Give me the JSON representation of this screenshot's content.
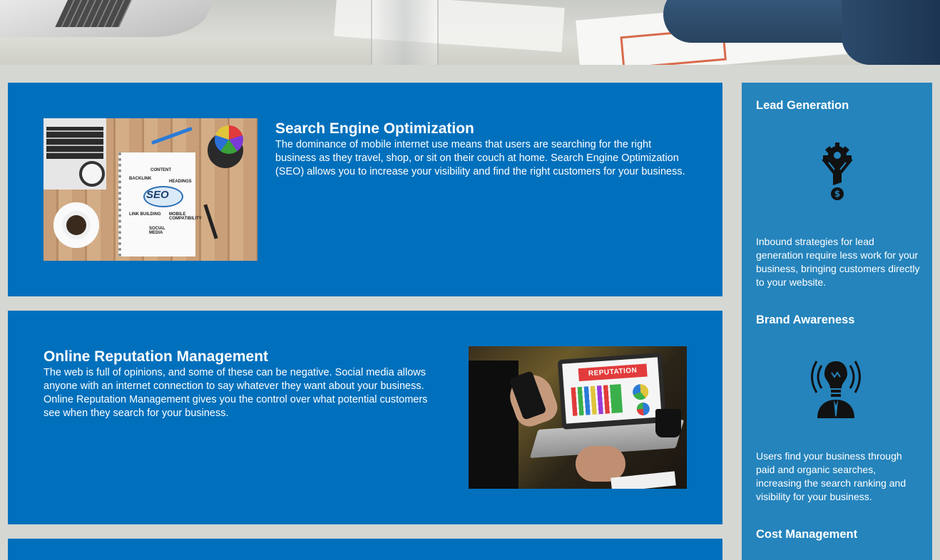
{
  "services": [
    {
      "title": "Search Engine Optimization",
      "description": "The dominance of mobile internet use means that users are searching for the right business as they travel, shop, or sit on their couch at home. Search Engine Optimization (SEO) allows you to increase your visibility and find the right customers for your business.",
      "image": {
        "cloud_text": "SEO",
        "labels": [
          "CONTENT",
          "BACKLINK",
          "HEADINGS",
          "LINK BUILDING",
          "MOBILE COMPATIBILITY",
          "SOCIAL MEDIA"
        ]
      }
    },
    {
      "title": "Online Reputation Management",
      "description": "The web is full of opinions, and some of these can be negative. Social media allows anyone with an internet connection to say whatever they want about your business. Online Reputation Management gives you the control over what potential customers see when they search for your business.",
      "image": {
        "banner_text": "REPUTATION"
      }
    }
  ],
  "sidebar": {
    "items": [
      {
        "title": "Lead Generation",
        "icon": "funnel-gear-dollar-icon",
        "description": "Inbound strategies for lead generation require less work for your business, bringing customers directly to your website."
      },
      {
        "title": "Brand Awareness",
        "icon": "lightbulb-broadcast-person-icon",
        "description": "Users find your business through paid and organic searches, increasing the search ranking and visibility for your business."
      },
      {
        "title": "Cost Management"
      }
    ]
  },
  "colors": {
    "page_background": "#d5d7d2",
    "card_background": "#0070bc",
    "sidebar_background": "#2584bc",
    "text": "#ffffff"
  }
}
